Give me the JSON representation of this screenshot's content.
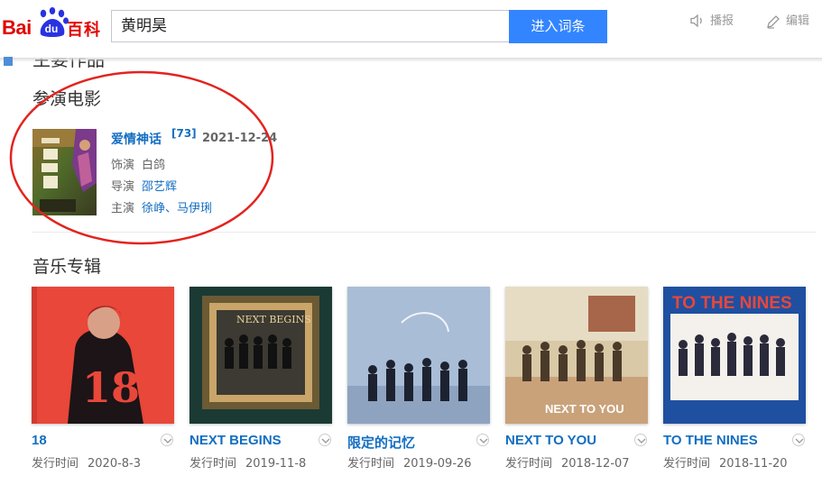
{
  "header": {
    "logo_text_bai": "Bai",
    "logo_text_du": "du",
    "logo_text_baike": "百科",
    "search_value": "黄明昊",
    "search_button": "进入词条",
    "broadcast_label": "播报",
    "edit_label": "编辑"
  },
  "colors": {
    "accent_blue": "#3385ff",
    "link_blue": "#136ec2",
    "baidu_red": "#e10601",
    "annotation_red": "#e3231f"
  },
  "partial_heading": "主要作品",
  "movies_section": {
    "title": "参演电影",
    "items": [
      {
        "name": "爱情神话",
        "ref": "[73]",
        "date": "2021-12-24",
        "role_label": "饰演",
        "role_value": "白鸽",
        "director_label": "导演",
        "director_value": "邵艺辉",
        "stars_label": "主演",
        "stars_value": "徐峥、马伊琍"
      }
    ]
  },
  "music_section": {
    "title": "音乐专辑",
    "release_label": "发行时间",
    "albums": [
      {
        "title": "18",
        "date": "2020-8-3"
      },
      {
        "title": "NEXT BEGINS",
        "date": "2019-11-8"
      },
      {
        "title": "限定的记忆",
        "date": "2019-09-26"
      },
      {
        "title": "NEXT TO YOU",
        "date": "2018-12-07"
      },
      {
        "title": "TO THE NINES",
        "date": "2018-11-20"
      }
    ]
  }
}
